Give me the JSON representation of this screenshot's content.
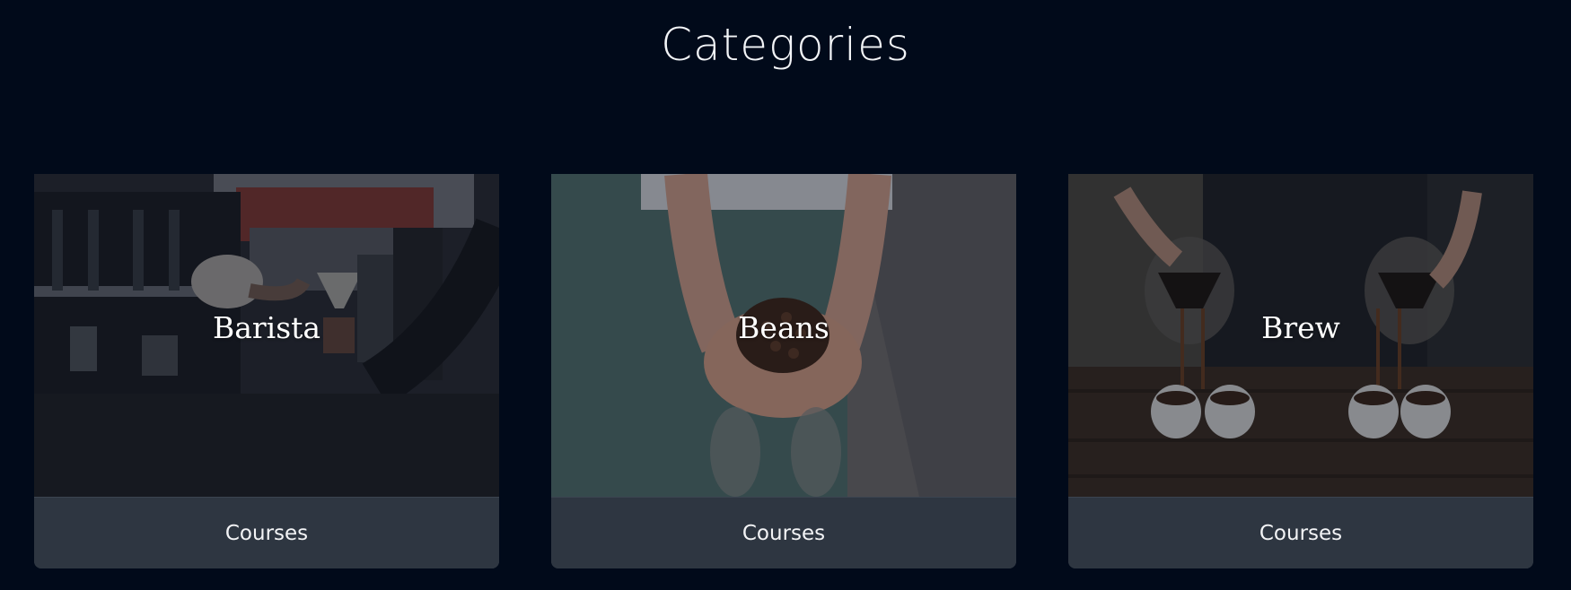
{
  "section": {
    "title": "Categories"
  },
  "cards": [
    {
      "title": "Barista",
      "footer_label": "Courses",
      "image": "barista-espresso-machine-photo"
    },
    {
      "title": "Beans",
      "footer_label": "Courses",
      "image": "hands-holding-coffee-beans-photo"
    },
    {
      "title": "Brew",
      "footer_label": "Courses",
      "image": "pour-over-coffee-cups-photo"
    }
  ],
  "colors": {
    "page_background": "#010a1a",
    "card_footer": "#2e3641",
    "text": "#ffffff"
  }
}
